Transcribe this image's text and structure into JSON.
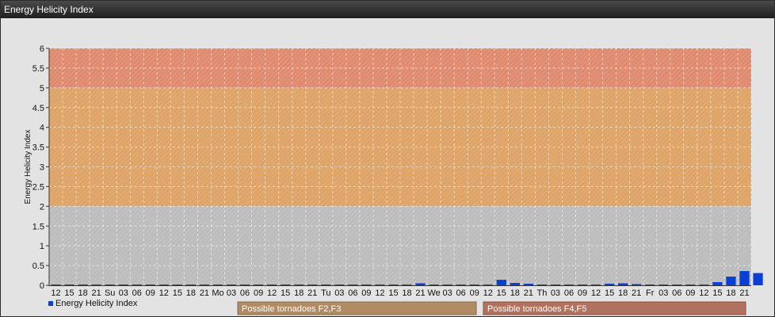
{
  "header": {
    "title": "Energy Helicity Index"
  },
  "chart_data": {
    "type": "bar",
    "title": "",
    "ylabel": "Energy Helicity Index",
    "xlabel": "",
    "ylim": [
      0,
      6
    ],
    "y_ticks": [
      "0",
      "0.5",
      "1",
      "1.5",
      "2",
      "2.5",
      "3",
      "3.5",
      "4",
      "4.5",
      "5",
      "5.5",
      "6"
    ],
    "grid": true,
    "categories": [
      "12",
      "15",
      "18",
      "21",
      "Su",
      "03",
      "06",
      "09",
      "12",
      "15",
      "18",
      "21",
      "Mo",
      "03",
      "06",
      "09",
      "12",
      "15",
      "18",
      "21",
      "Tu",
      "03",
      "06",
      "09",
      "12",
      "15",
      "18",
      "21",
      "We",
      "03",
      "06",
      "09",
      "12",
      "15",
      "18",
      "21",
      "Th",
      "03",
      "06",
      "09",
      "12",
      "15",
      "18",
      "21",
      "Fr",
      "03",
      "06",
      "09",
      "12",
      "15",
      "18",
      "21"
    ],
    "series": [
      {
        "name": "Energy Helicity Index",
        "color": "#0a3fd6",
        "values": [
          0.01,
          0.01,
          0.01,
          0.01,
          0.01,
          0.01,
          0.01,
          0.01,
          0.01,
          0.01,
          0.01,
          0.01,
          0.01,
          0.01,
          0.01,
          0.01,
          0.01,
          0.01,
          0.01,
          0.01,
          0.01,
          0.01,
          0.01,
          0.01,
          0.01,
          0.02,
          0.02,
          0.05,
          0.01,
          0.01,
          0.01,
          0.01,
          0.02,
          0.14,
          0.06,
          0.04,
          0.02,
          0.01,
          0.01,
          0.01,
          0.01,
          0.04,
          0.05,
          0.03,
          0.01,
          0.01,
          0.01,
          0.01,
          0.01,
          0.08,
          0.22,
          0.36,
          0.31
        ]
      }
    ],
    "bands": [
      {
        "from": 0,
        "to": 2,
        "color": "#bcbcbc"
      },
      {
        "from": 2,
        "to": 5,
        "color": "#dea366",
        "label": "Possible tornadoes F2,F3"
      },
      {
        "from": 5,
        "to": 6,
        "color": "#df8a6f",
        "label": "Possible tornadoes F4,F5"
      }
    ],
    "legend": {
      "position": "bottom-left"
    }
  },
  "zones": {
    "f2f3": {
      "label": "Possible tornadoes F2,F3",
      "color": "#b08b63"
    },
    "f4f5": {
      "label": "Possible tornadoes F4,F5",
      "color": "#b1725f"
    }
  }
}
